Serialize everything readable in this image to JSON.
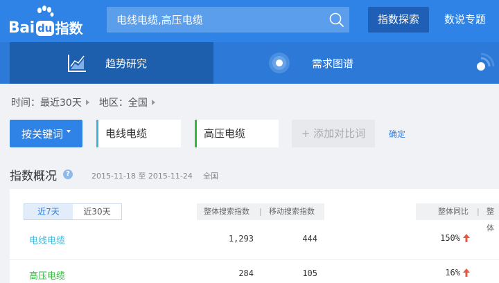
{
  "header": {
    "logo_bai": "Bai",
    "logo_du": "du",
    "logo_product": "指数",
    "search_value": "电线电缆,高压电缆",
    "explore_label": "指数探索",
    "topic_label": "数说专题"
  },
  "nav": {
    "trend": "趋势研究",
    "demand": "需求图谱"
  },
  "filters": {
    "time": "时间：最近30天",
    "region": "地区：全国"
  },
  "keywords": {
    "button_label": "按关键词",
    "kw1": "电线电缆",
    "kw2": "高压电缆",
    "add_label": "+ 添加对比词",
    "confirm": "确定"
  },
  "overview": {
    "title": "指数概况",
    "help": "?",
    "date_range": "2015-11-18 至 2015-11-24",
    "region": "全国",
    "tabs": [
      "近7天",
      "近30天"
    ],
    "col_total": "整体搜索指数",
    "col_sep": "|",
    "col_mobile": "移动搜索指数",
    "col_yoy": "整体同比",
    "col_yoy_sep": "|",
    "col_yoy2": "整体",
    "rows": [
      {
        "name": "电线电缆",
        "total": "1,293",
        "mobile": "444",
        "yoy": "150%"
      },
      {
        "name": "高压电缆",
        "total": "284",
        "mobile": "105",
        "yoy": "16%"
      }
    ]
  },
  "colors": {
    "brand": "#2f83e6",
    "kw1": "#3ab7d8",
    "kw2": "#31b93c",
    "up": "#e8573f"
  }
}
